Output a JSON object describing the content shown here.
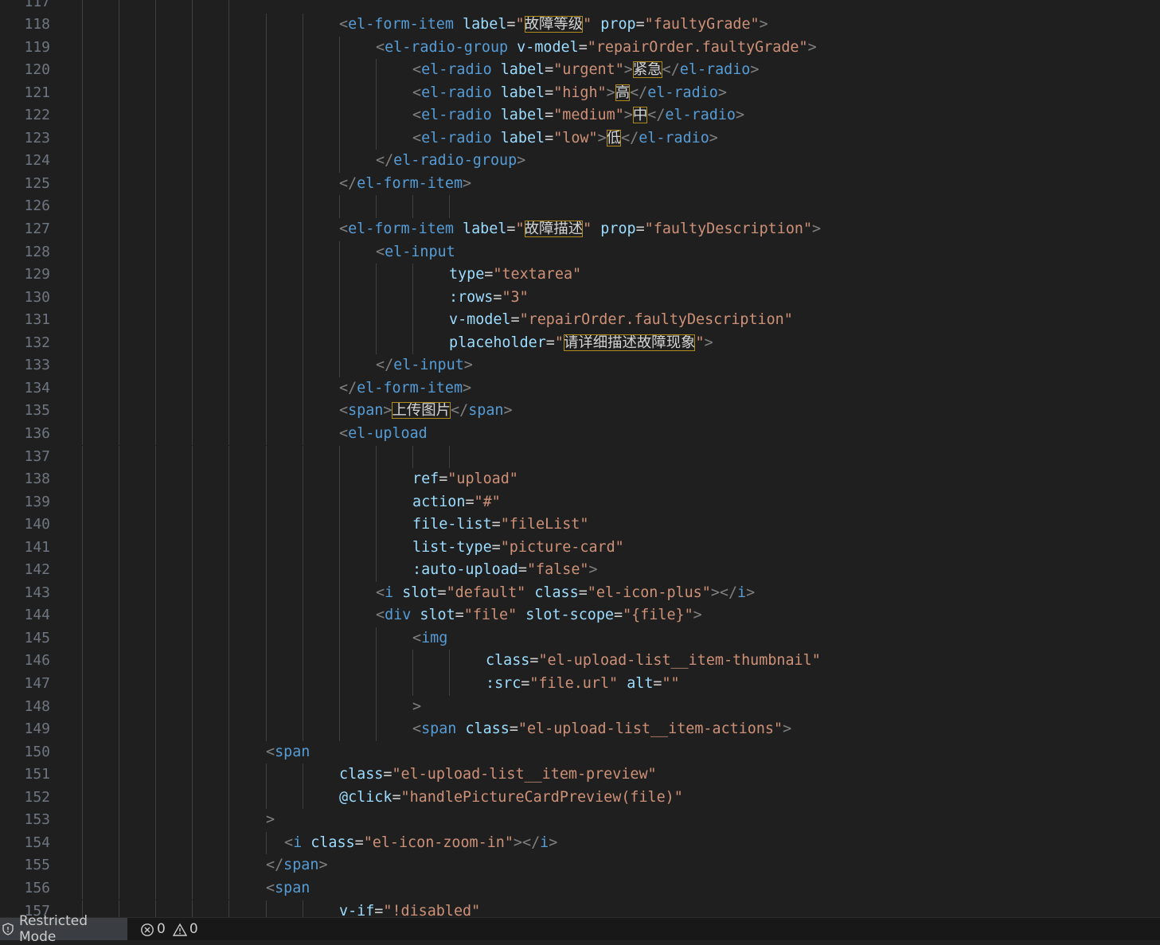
{
  "editor": {
    "lines": [
      {
        "n": "117",
        "indent": 0,
        "tokens": []
      },
      {
        "n": "118",
        "indent": 0,
        "tokens": [
          [
            "punct",
            "<"
          ],
          [
            "tag",
            "el-form-item"
          ],
          [
            "op",
            " "
          ],
          [
            "attr",
            "label"
          ],
          [
            "op",
            "="
          ],
          [
            "str",
            "\""
          ],
          [
            "cjk",
            "故障等级"
          ],
          [
            "str",
            "\""
          ],
          [
            "op",
            " "
          ],
          [
            "attr",
            "prop"
          ],
          [
            "op",
            "="
          ],
          [
            "str",
            "\"faultyGrade\""
          ],
          [
            "punct",
            ">"
          ]
        ]
      },
      {
        "n": "119",
        "indent": 0,
        "tokens": [
          [
            "punct",
            "<"
          ],
          [
            "tag",
            "el-radio-group"
          ],
          [
            "op",
            " "
          ],
          [
            "attr",
            "v-model"
          ],
          [
            "op",
            "="
          ],
          [
            "str",
            "\"repairOrder.faultyGrade\""
          ],
          [
            "punct",
            ">"
          ]
        ]
      },
      {
        "n": "120",
        "indent": 0,
        "tokens": [
          [
            "punct",
            "<"
          ],
          [
            "tag",
            "el-radio"
          ],
          [
            "op",
            " "
          ],
          [
            "attr",
            "label"
          ],
          [
            "op",
            "="
          ],
          [
            "str",
            "\"urgent\""
          ],
          [
            "punct",
            ">"
          ],
          [
            "cjk",
            "紧急"
          ],
          [
            "punct",
            "</"
          ],
          [
            "tag",
            "el-radio"
          ],
          [
            "punct",
            ">"
          ]
        ]
      },
      {
        "n": "121",
        "indent": 0,
        "tokens": [
          [
            "punct",
            "<"
          ],
          [
            "tag",
            "el-radio"
          ],
          [
            "op",
            " "
          ],
          [
            "attr",
            "label"
          ],
          [
            "op",
            "="
          ],
          [
            "str",
            "\"high\""
          ],
          [
            "punct",
            ">"
          ],
          [
            "cjk",
            "高"
          ],
          [
            "punct",
            "</"
          ],
          [
            "tag",
            "el-radio"
          ],
          [
            "punct",
            ">"
          ]
        ]
      },
      {
        "n": "122",
        "indent": 0,
        "tokens": [
          [
            "punct",
            "<"
          ],
          [
            "tag",
            "el-radio"
          ],
          [
            "op",
            " "
          ],
          [
            "attr",
            "label"
          ],
          [
            "op",
            "="
          ],
          [
            "str",
            "\"medium\""
          ],
          [
            "punct",
            ">"
          ],
          [
            "cjk",
            "中"
          ],
          [
            "punct",
            "</"
          ],
          [
            "tag",
            "el-radio"
          ],
          [
            "punct",
            ">"
          ]
        ]
      },
      {
        "n": "123",
        "indent": 0,
        "tokens": [
          [
            "punct",
            "<"
          ],
          [
            "tag",
            "el-radio"
          ],
          [
            "op",
            " "
          ],
          [
            "attr",
            "label"
          ],
          [
            "op",
            "="
          ],
          [
            "str",
            "\"low\""
          ],
          [
            "punct",
            ">"
          ],
          [
            "cjk",
            "低"
          ],
          [
            "punct",
            "</"
          ],
          [
            "tag",
            "el-radio"
          ],
          [
            "punct",
            ">"
          ]
        ]
      },
      {
        "n": "124",
        "indent": 0,
        "tokens": [
          [
            "punct",
            "</"
          ],
          [
            "tag",
            "el-radio-group"
          ],
          [
            "punct",
            ">"
          ]
        ]
      },
      {
        "n": "125",
        "indent": 0,
        "tokens": [
          [
            "punct",
            "</"
          ],
          [
            "tag",
            "el-form-item"
          ],
          [
            "punct",
            ">"
          ]
        ]
      },
      {
        "n": "126",
        "indent": 0,
        "tokens": []
      },
      {
        "n": "127",
        "indent": 0,
        "tokens": [
          [
            "punct",
            "<"
          ],
          [
            "tag",
            "el-form-item"
          ],
          [
            "op",
            " "
          ],
          [
            "attr",
            "label"
          ],
          [
            "op",
            "="
          ],
          [
            "str",
            "\""
          ],
          [
            "cjk",
            "故障描述"
          ],
          [
            "str",
            "\""
          ],
          [
            "op",
            " "
          ],
          [
            "attr",
            "prop"
          ],
          [
            "op",
            "="
          ],
          [
            "str",
            "\"faultyDescription\""
          ],
          [
            "punct",
            ">"
          ]
        ]
      },
      {
        "n": "128",
        "indent": 0,
        "tokens": [
          [
            "punct",
            "<"
          ],
          [
            "tag",
            "el-input"
          ]
        ]
      },
      {
        "n": "129",
        "indent": 0,
        "tokens": [
          [
            "attr",
            "type"
          ],
          [
            "op",
            "="
          ],
          [
            "str",
            "\"textarea\""
          ]
        ]
      },
      {
        "n": "130",
        "indent": 0,
        "tokens": [
          [
            "attr",
            ":rows"
          ],
          [
            "op",
            "="
          ],
          [
            "str",
            "\"3\""
          ]
        ]
      },
      {
        "n": "131",
        "indent": 0,
        "tokens": [
          [
            "attr",
            "v-model"
          ],
          [
            "op",
            "="
          ],
          [
            "str",
            "\"repairOrder.faultyDescription\""
          ]
        ]
      },
      {
        "n": "132",
        "indent": 0,
        "tokens": [
          [
            "attr",
            "placeholder"
          ],
          [
            "op",
            "="
          ],
          [
            "str",
            "\""
          ],
          [
            "cjk",
            "请详细描述故障现象"
          ],
          [
            "str",
            "\""
          ],
          [
            "punct",
            ">"
          ]
        ]
      },
      {
        "n": "133",
        "indent": 0,
        "tokens": [
          [
            "punct",
            "</"
          ],
          [
            "tag",
            "el-input"
          ],
          [
            "punct",
            ">"
          ]
        ]
      },
      {
        "n": "134",
        "indent": 0,
        "tokens": [
          [
            "punct",
            "</"
          ],
          [
            "tag",
            "el-form-item"
          ],
          [
            "punct",
            ">"
          ]
        ]
      },
      {
        "n": "135",
        "indent": 0,
        "tokens": [
          [
            "punct",
            "<"
          ],
          [
            "tag",
            "span"
          ],
          [
            "punct",
            ">"
          ],
          [
            "cjk",
            "上传图片"
          ],
          [
            "punct",
            "</"
          ],
          [
            "tag",
            "span"
          ],
          [
            "punct",
            ">"
          ]
        ]
      },
      {
        "n": "136",
        "indent": 0,
        "tokens": [
          [
            "punct",
            "<"
          ],
          [
            "tag",
            "el-upload"
          ]
        ]
      },
      {
        "n": "137",
        "indent": 0,
        "tokens": []
      },
      {
        "n": "138",
        "indent": 0,
        "tokens": [
          [
            "attr",
            "ref"
          ],
          [
            "op",
            "="
          ],
          [
            "str",
            "\"upload\""
          ]
        ]
      },
      {
        "n": "139",
        "indent": 0,
        "tokens": [
          [
            "attr",
            "action"
          ],
          [
            "op",
            "="
          ],
          [
            "str",
            "\"#\""
          ]
        ]
      },
      {
        "n": "140",
        "indent": 0,
        "tokens": [
          [
            "attr",
            "file-list"
          ],
          [
            "op",
            "="
          ],
          [
            "str",
            "\"fileList\""
          ]
        ]
      },
      {
        "n": "141",
        "indent": 0,
        "tokens": [
          [
            "attr",
            "list-type"
          ],
          [
            "op",
            "="
          ],
          [
            "str",
            "\"picture-card\""
          ]
        ]
      },
      {
        "n": "142",
        "indent": 0,
        "tokens": [
          [
            "attr",
            ":auto-upload"
          ],
          [
            "op",
            "="
          ],
          [
            "str",
            "\"false\""
          ],
          [
            "punct",
            ">"
          ]
        ]
      },
      {
        "n": "143",
        "indent": 0,
        "tokens": [
          [
            "punct",
            "<"
          ],
          [
            "tag",
            "i"
          ],
          [
            "op",
            " "
          ],
          [
            "attr",
            "slot"
          ],
          [
            "op",
            "="
          ],
          [
            "str",
            "\"default\""
          ],
          [
            "op",
            " "
          ],
          [
            "attr",
            "class"
          ],
          [
            "op",
            "="
          ],
          [
            "str",
            "\"el-icon-plus\""
          ],
          [
            "punct",
            "></"
          ],
          [
            "tag",
            "i"
          ],
          [
            "punct",
            ">"
          ]
        ]
      },
      {
        "n": "144",
        "indent": 0,
        "tokens": [
          [
            "punct",
            "<"
          ],
          [
            "tag",
            "div"
          ],
          [
            "op",
            " "
          ],
          [
            "attr",
            "slot"
          ],
          [
            "op",
            "="
          ],
          [
            "str",
            "\"file\""
          ],
          [
            "op",
            " "
          ],
          [
            "attr",
            "slot-scope"
          ],
          [
            "op",
            "="
          ],
          [
            "str",
            "\"{file}\""
          ],
          [
            "punct",
            ">"
          ]
        ]
      },
      {
        "n": "145",
        "indent": 0,
        "tokens": [
          [
            "punct",
            "<"
          ],
          [
            "tag",
            "img"
          ]
        ]
      },
      {
        "n": "146",
        "indent": 0,
        "tokens": [
          [
            "attr",
            "class"
          ],
          [
            "op",
            "="
          ],
          [
            "str",
            "\"el-upload-list__item-thumbnail\""
          ]
        ]
      },
      {
        "n": "147",
        "indent": 0,
        "tokens": [
          [
            "attr",
            ":src"
          ],
          [
            "op",
            "="
          ],
          [
            "str",
            "\"file.url\""
          ],
          [
            "op",
            " "
          ],
          [
            "attr",
            "alt"
          ],
          [
            "op",
            "="
          ],
          [
            "str",
            "\"\""
          ]
        ]
      },
      {
        "n": "148",
        "indent": 0,
        "tokens": [
          [
            "punct",
            ">"
          ]
        ]
      },
      {
        "n": "149",
        "indent": 0,
        "tokens": [
          [
            "punct",
            "<"
          ],
          [
            "tag",
            "span"
          ],
          [
            "op",
            " "
          ],
          [
            "attr",
            "class"
          ],
          [
            "op",
            "="
          ],
          [
            "str",
            "\"el-upload-list__item-actions\""
          ],
          [
            "punct",
            ">"
          ]
        ]
      },
      {
        "n": "150",
        "indent": 0,
        "tokens": [
          [
            "punct",
            "<"
          ],
          [
            "tag",
            "span"
          ]
        ]
      },
      {
        "n": "151",
        "indent": 0,
        "tokens": [
          [
            "attr",
            "class"
          ],
          [
            "op",
            "="
          ],
          [
            "str",
            "\"el-upload-list__item-preview\""
          ]
        ]
      },
      {
        "n": "152",
        "indent": 0,
        "tokens": [
          [
            "attr",
            "@click"
          ],
          [
            "op",
            "="
          ],
          [
            "str",
            "\"handlePictureCardPreview(file)\""
          ]
        ]
      },
      {
        "n": "153",
        "indent": 0,
        "tokens": [
          [
            "punct",
            ">"
          ]
        ]
      },
      {
        "n": "154",
        "indent": 0,
        "tokens": [
          [
            "punct",
            "<"
          ],
          [
            "tag",
            "i"
          ],
          [
            "op",
            " "
          ],
          [
            "attr",
            "class"
          ],
          [
            "op",
            "="
          ],
          [
            "str",
            "\"el-icon-zoom-in\""
          ],
          [
            "punct",
            "></"
          ],
          [
            "tag",
            "i"
          ],
          [
            "punct",
            ">"
          ]
        ]
      },
      {
        "n": "155",
        "indent": 0,
        "tokens": [
          [
            "punct",
            "</"
          ],
          [
            "tag",
            "span"
          ],
          [
            "punct",
            ">"
          ]
        ]
      },
      {
        "n": "156",
        "indent": 0,
        "tokens": [
          [
            "punct",
            "<"
          ],
          [
            "tag",
            "span"
          ]
        ]
      },
      {
        "n": "157",
        "indent": 0,
        "tokens": [
          [
            "attr",
            "v-if"
          ],
          [
            "op",
            "="
          ],
          [
            "str",
            "\"!disabled\""
          ]
        ]
      }
    ]
  },
  "statusbar": {
    "mode_label": "Restricted Mode",
    "errors": "0",
    "warnings": "0"
  }
}
